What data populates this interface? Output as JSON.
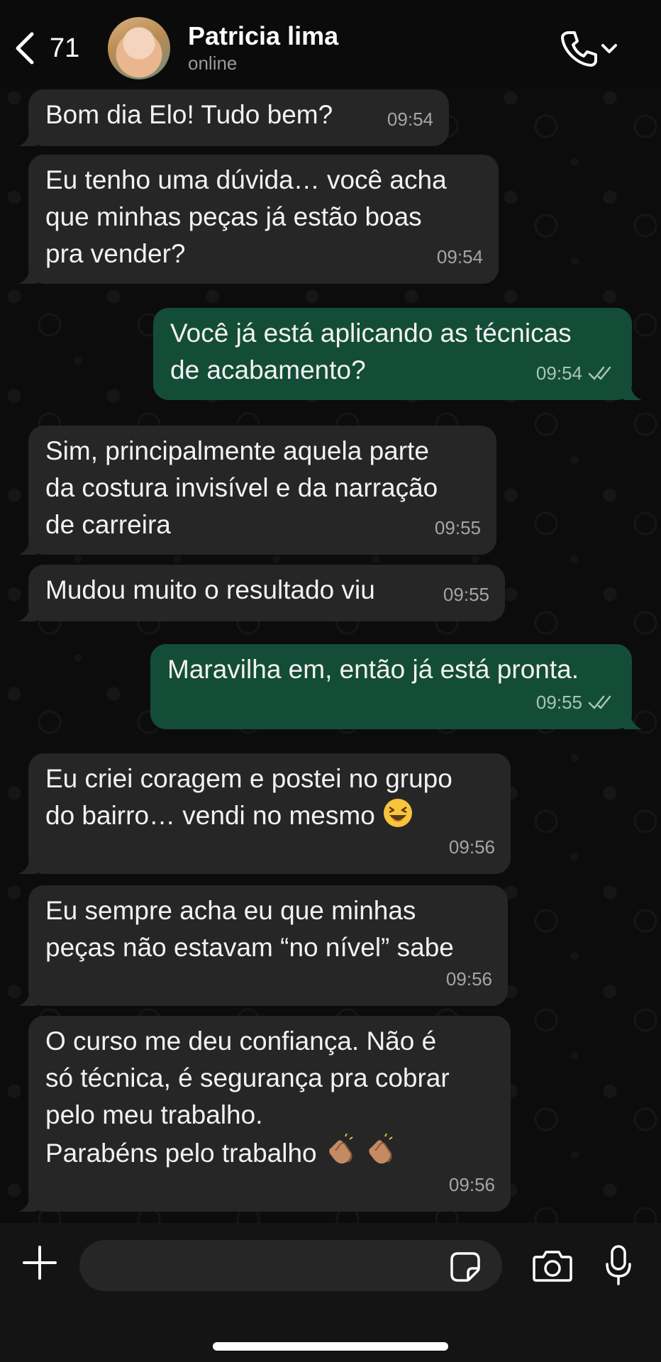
{
  "header": {
    "back_count": "71",
    "contact_name": "Patricia lima",
    "contact_status": "online"
  },
  "messages": [
    {
      "direction": "in",
      "text": "Bom dia Elo! Tudo bem?",
      "time": "09:54"
    },
    {
      "direction": "in",
      "text": "Eu tenho uma dúvida… você acha\nque minhas peças já estão boas\npra vender?",
      "time": "09:54"
    },
    {
      "direction": "out",
      "text": "Você já está aplicando as técnicas\nde acabamento?",
      "time": "09:54",
      "status": "read"
    },
    {
      "direction": "in",
      "text": "Sim, principalmente aquela parte\nda costura invisível e da narração\nde carreira",
      "time": "09:55"
    },
    {
      "direction": "in",
      "text": "Mudou muito o resultado viu",
      "time": "09:55"
    },
    {
      "direction": "out",
      "text": "Maravilha em, então já está pronta.",
      "time": "09:55",
      "status": "read"
    },
    {
      "direction": "in",
      "text": "Eu criei coragem e postei no grupo\ndo bairro… vendi no mesmo",
      "emoji": "laughing-face",
      "time": "09:56"
    },
    {
      "direction": "in",
      "text": "Eu sempre acha eu que minhas\npeças não estavam “no nível” sabe",
      "time": "09:56"
    },
    {
      "direction": "in",
      "text": "O curso me deu confiança. Não é\nsó técnica, é segurança pra cobrar\npelo meu trabalho.\nParabéns pelo trabalho",
      "emoji": "clapping-hands x2",
      "time": "09:56"
    }
  ],
  "composer": {
    "input_value": "",
    "input_placeholder": ""
  },
  "icons": {
    "back": "chevron-left-icon",
    "call": "phone-icon",
    "add": "plus-icon",
    "sticker": "sticker-icon",
    "camera": "camera-icon",
    "mic": "microphone-icon"
  },
  "colors": {
    "incoming_bubble": "#262626",
    "outgoing_bubble": "#144d37",
    "read_ticks": "#a9c4b8"
  }
}
